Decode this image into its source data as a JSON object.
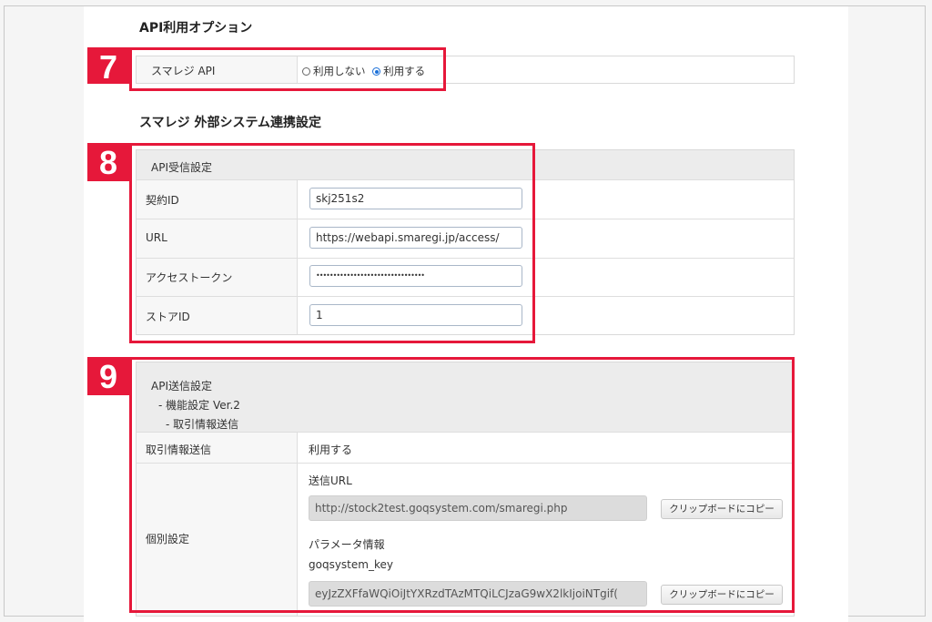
{
  "section_api_option": {
    "title": "API利用オプション",
    "row_label": "スマレジ API",
    "options": [
      {
        "label": "利用しない",
        "selected": false
      },
      {
        "label": "利用する",
        "selected": true
      }
    ],
    "badge": "7"
  },
  "section_external": {
    "title": "スマレジ 外部システム連携設定"
  },
  "receive_settings": {
    "badge": "8",
    "header": "API受信設定",
    "rows": [
      {
        "label": "契約ID",
        "value": "skj251s2"
      },
      {
        "label": "URL",
        "value": "https://webapi.smaregi.jp/access/"
      },
      {
        "label": "アクセストークン",
        "value": "••••••••••••••••••••••••••••••••"
      },
      {
        "label": "ストアID",
        "value": "1"
      }
    ]
  },
  "send_settings": {
    "badge": "9",
    "header_lines": [
      "API送信設定",
      "- 機能設定 Ver.2",
      "- 取引情報送信"
    ],
    "transaction_label": "取引情報送信",
    "transaction_value": "利用する",
    "individual_label": "個別設定",
    "send_url_label": "送信URL",
    "send_url_value": "http://stock2test.goqsystem.com/smaregi.php",
    "copy_button_label": "クリップボードにコピー",
    "param_label": "パラメータ情報",
    "param_key": "goqsystem_key",
    "param_value": "eyJzZXFfaWQiOiJtYXRzdTAzMTQiLCJzaG9wX2lkIjoiNTgif(",
    "copy_button_label_2": "クリップボードにコピー"
  },
  "colors": {
    "highlight": "#e6183a",
    "radio_selected": "#1a6fd8"
  }
}
